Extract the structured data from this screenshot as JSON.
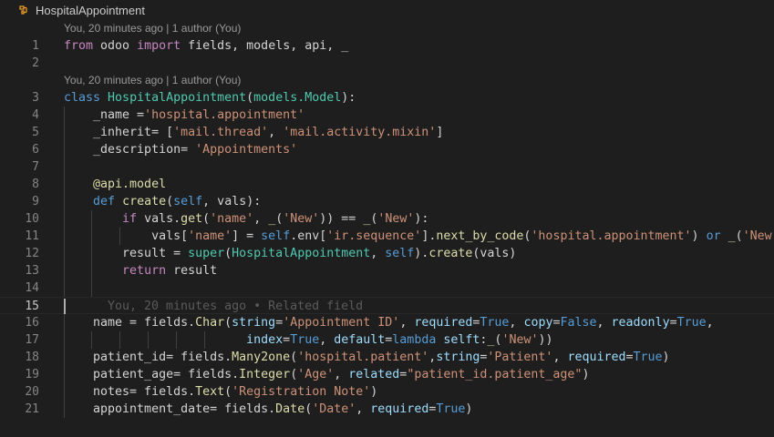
{
  "breadcrumb": {
    "label": "HospitalAppointment",
    "icon": "class-symbol-icon"
  },
  "codelens": [
    {
      "text": "You, 20 minutes ago | 1 author (You)"
    },
    {
      "text": "You, 20 minutes ago | 1 author (You)"
    }
  ],
  "ghost_blame": "You, 20 minutes ago • Related field",
  "colors": {
    "background": "#1e1e1e",
    "keyword": "#569cd6",
    "control": "#c586c0",
    "class": "#4ec9b0",
    "function": "#dcdcaa",
    "string": "#ce9178",
    "variable": "#9cdcfe"
  },
  "lines": [
    {
      "n": "1",
      "tokens": [
        [
          "kc",
          "from"
        ],
        [
          "d",
          " odoo "
        ],
        [
          "kc",
          "import"
        ],
        [
          "d",
          " fields, models, api, _"
        ]
      ]
    },
    {
      "n": "2",
      "tokens": []
    },
    {
      "n": "3",
      "tokens": [
        [
          "k",
          "class"
        ],
        [
          "d",
          " "
        ],
        [
          "c",
          "HospitalAppointment"
        ],
        [
          "d",
          "("
        ],
        [
          "c",
          "models.Model"
        ],
        [
          "d",
          "):"
        ]
      ]
    },
    {
      "n": "4",
      "tokens": [
        [
          "d",
          "    _name ="
        ],
        [
          "s",
          "'hospital.appointment'"
        ]
      ]
    },
    {
      "n": "5",
      "tokens": [
        [
          "d",
          "    _inherit= ["
        ],
        [
          "s",
          "'mail.thread'"
        ],
        [
          "d",
          ", "
        ],
        [
          "s",
          "'mail.activity.mixin'"
        ],
        [
          "d",
          "]"
        ]
      ]
    },
    {
      "n": "6",
      "tokens": [
        [
          "d",
          "    _description= "
        ],
        [
          "s",
          "'Appointments'"
        ]
      ]
    },
    {
      "n": "7",
      "tokens": []
    },
    {
      "n": "8",
      "tokens": [
        [
          "f",
          "    @api.model"
        ]
      ]
    },
    {
      "n": "9",
      "tokens": [
        [
          "d",
          "    "
        ],
        [
          "k",
          "def"
        ],
        [
          "d",
          " "
        ],
        [
          "f",
          "create"
        ],
        [
          "d",
          "("
        ],
        [
          "k",
          "self"
        ],
        [
          "d",
          ", vals):"
        ]
      ]
    },
    {
      "n": "10",
      "tokens": [
        [
          "d",
          "        "
        ],
        [
          "kc",
          "if"
        ],
        [
          "d",
          " vals."
        ],
        [
          "f",
          "get"
        ],
        [
          "d",
          "("
        ],
        [
          "s",
          "'name'"
        ],
        [
          "d",
          ", "
        ],
        [
          "f",
          "_"
        ],
        [
          "d",
          "("
        ],
        [
          "s",
          "'New'"
        ],
        [
          "d",
          ")) == "
        ],
        [
          "f",
          "_"
        ],
        [
          "d",
          "("
        ],
        [
          "s",
          "'New'"
        ],
        [
          "d",
          "):"
        ]
      ]
    },
    {
      "n": "11",
      "tokens": [
        [
          "d",
          "            vals["
        ],
        [
          "s",
          "'name'"
        ],
        [
          "d",
          "] = "
        ],
        [
          "k",
          "self"
        ],
        [
          "d",
          ".env["
        ],
        [
          "s",
          "'ir.sequence'"
        ],
        [
          "d",
          "]."
        ],
        [
          "f",
          "next_by_code"
        ],
        [
          "d",
          "("
        ],
        [
          "s",
          "'hospital.appointment'"
        ],
        [
          "d",
          ") "
        ],
        [
          "k",
          "or"
        ],
        [
          "d",
          " "
        ],
        [
          "f",
          "_"
        ],
        [
          "d",
          "("
        ],
        [
          "s",
          "'New'"
        ],
        [
          "d",
          ")"
        ]
      ]
    },
    {
      "n": "12",
      "tokens": [
        [
          "d",
          "        result = "
        ],
        [
          "c",
          "super"
        ],
        [
          "d",
          "("
        ],
        [
          "c",
          "HospitalAppointment"
        ],
        [
          "d",
          ", "
        ],
        [
          "k",
          "self"
        ],
        [
          "d",
          ")."
        ],
        [
          "f",
          "create"
        ],
        [
          "d",
          "(vals)"
        ]
      ]
    },
    {
      "n": "13",
      "tokens": [
        [
          "d",
          "        "
        ],
        [
          "kc",
          "return"
        ],
        [
          "d",
          " result"
        ]
      ]
    },
    {
      "n": "14",
      "tokens": []
    },
    {
      "n": "15",
      "tokens": []
    },
    {
      "n": "16",
      "tokens": [
        [
          "d",
          "    name = fields."
        ],
        [
          "f",
          "Char"
        ],
        [
          "d",
          "("
        ],
        [
          "v",
          "string"
        ],
        [
          "d",
          "="
        ],
        [
          "s",
          "'Appointment ID'"
        ],
        [
          "d",
          ", "
        ],
        [
          "v",
          "required"
        ],
        [
          "d",
          "="
        ],
        [
          "k",
          "True"
        ],
        [
          "d",
          ", "
        ],
        [
          "v",
          "copy"
        ],
        [
          "d",
          "="
        ],
        [
          "k",
          "False"
        ],
        [
          "d",
          ", "
        ],
        [
          "v",
          "readonly"
        ],
        [
          "d",
          "="
        ],
        [
          "k",
          "True"
        ],
        [
          "d",
          ","
        ]
      ]
    },
    {
      "n": "17",
      "tokens": [
        [
          "d",
          "                         "
        ],
        [
          "v",
          "index"
        ],
        [
          "d",
          "="
        ],
        [
          "k",
          "True"
        ],
        [
          "d",
          ", "
        ],
        [
          "v",
          "default"
        ],
        [
          "d",
          "="
        ],
        [
          "k",
          "lambda"
        ],
        [
          "d",
          " "
        ],
        [
          "v",
          "selft"
        ],
        [
          "d",
          ":"
        ],
        [
          "f",
          "_"
        ],
        [
          "d",
          "("
        ],
        [
          "s",
          "'New'"
        ],
        [
          "d",
          "))"
        ]
      ]
    },
    {
      "n": "18",
      "tokens": [
        [
          "d",
          "    patient_id= fields."
        ],
        [
          "f",
          "Many2one"
        ],
        [
          "d",
          "("
        ],
        [
          "s",
          "'hospital.patient'"
        ],
        [
          "d",
          ","
        ],
        [
          "v",
          "string"
        ],
        [
          "d",
          "="
        ],
        [
          "s",
          "'Patient'"
        ],
        [
          "d",
          ", "
        ],
        [
          "v",
          "required"
        ],
        [
          "d",
          "="
        ],
        [
          "k",
          "True"
        ],
        [
          "d",
          ")"
        ]
      ]
    },
    {
      "n": "19",
      "tokens": [
        [
          "d",
          "    patient_age= fields."
        ],
        [
          "f",
          "Integer"
        ],
        [
          "d",
          "("
        ],
        [
          "s",
          "'Age'"
        ],
        [
          "d",
          ", "
        ],
        [
          "v",
          "related"
        ],
        [
          "d",
          "="
        ],
        [
          "s",
          "\"patient_id.patient_age\""
        ],
        [
          "d",
          ")"
        ]
      ]
    },
    {
      "n": "20",
      "tokens": [
        [
          "d",
          "    notes= fields."
        ],
        [
          "f",
          "Text"
        ],
        [
          "d",
          "("
        ],
        [
          "s",
          "'Registration Note'"
        ],
        [
          "d",
          ")"
        ]
      ]
    },
    {
      "n": "21",
      "tokens": [
        [
          "d",
          "    appointment_date= fields."
        ],
        [
          "f",
          "Date"
        ],
        [
          "d",
          "("
        ],
        [
          "s",
          "'Date'"
        ],
        [
          "d",
          ", "
        ],
        [
          "v",
          "required"
        ],
        [
          "d",
          "="
        ],
        [
          "k",
          "True"
        ],
        [
          "d",
          ")"
        ]
      ]
    }
  ]
}
